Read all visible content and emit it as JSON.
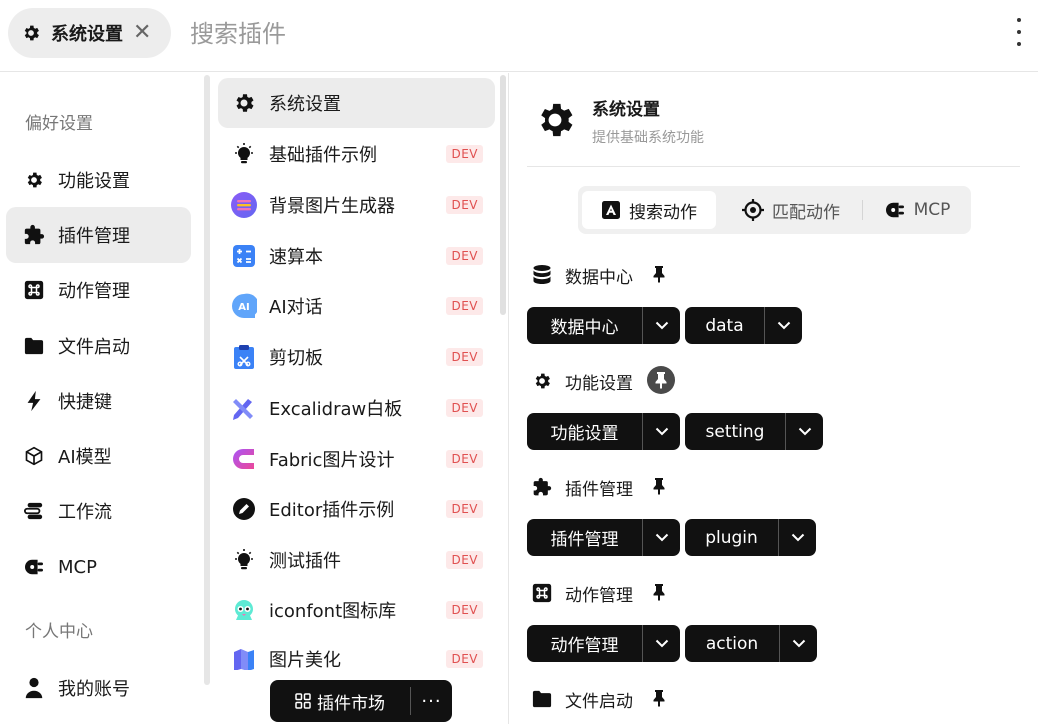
{
  "topbar": {
    "tab_label": "系统设置",
    "tab_close": "✕",
    "search_placeholder": "搜索插件"
  },
  "sidebar": {
    "section_preferences": "偏好设置",
    "section_personal": "个人中心",
    "items": [
      {
        "label": "功能设置",
        "icon": "gear-icon"
      },
      {
        "label": "插件管理",
        "icon": "puzzle-icon"
      },
      {
        "label": "动作管理",
        "icon": "command-icon"
      },
      {
        "label": "文件启动",
        "icon": "folder-icon"
      },
      {
        "label": "快捷键",
        "icon": "bolt-icon"
      },
      {
        "label": "AI模型",
        "icon": "cube-icon"
      },
      {
        "label": "工作流",
        "icon": "workflow-icon"
      },
      {
        "label": "MCP",
        "icon": "mcp-plug-icon"
      }
    ],
    "personal_items": [
      {
        "label": "我的账号",
        "icon": "user-icon"
      }
    ],
    "active_item": "插件管理"
  },
  "plugin_list": {
    "items": [
      {
        "label": "系统设置",
        "icon": "gear-icon",
        "badge": ""
      },
      {
        "label": "基础插件示例",
        "icon": "lightbulb-icon",
        "badge": "DEV"
      },
      {
        "label": "背景图片生成器",
        "icon": "gradient-icon",
        "badge": "DEV"
      },
      {
        "label": "速算本",
        "icon": "calculator-icon",
        "badge": "DEV"
      },
      {
        "label": "AI对话",
        "icon": "ai-chat-icon",
        "badge": "DEV"
      },
      {
        "label": "剪切板",
        "icon": "clipboard-icon",
        "badge": "DEV"
      },
      {
        "label": "Excalidraw白板",
        "icon": "excalidraw-icon",
        "badge": "DEV"
      },
      {
        "label": "Fabric图片设计",
        "icon": "fabric-icon",
        "badge": "DEV"
      },
      {
        "label": "Editor插件示例",
        "icon": "pen-icon",
        "badge": "DEV"
      },
      {
        "label": "测试插件",
        "icon": "lightbulb-icon",
        "badge": "DEV"
      },
      {
        "label": "iconfont图标库",
        "icon": "iconfont-icon",
        "badge": "DEV"
      },
      {
        "label": "图片美化",
        "icon": "image-beautify-icon",
        "badge": "DEV"
      }
    ],
    "active_item": "系统设置",
    "market_button": "插件市场",
    "more_button": "···"
  },
  "detail": {
    "title": "系统设置",
    "subtitle": "提供基础系统功能",
    "tabs": [
      {
        "label": "搜索动作",
        "icon": "letter-a-icon",
        "active": true
      },
      {
        "label": "匹配动作",
        "icon": "target-icon",
        "active": false
      },
      {
        "label": "MCP",
        "icon": "mcp-plug-icon",
        "active": false
      }
    ],
    "features": [
      {
        "label": "数据中心",
        "icon": "database-icon",
        "pinned": false,
        "value": "数据中心",
        "code": "data"
      },
      {
        "label": "功能设置",
        "icon": "gear-icon",
        "pinned": true,
        "value": "功能设置",
        "code": "setting"
      },
      {
        "label": "插件管理",
        "icon": "puzzle-icon",
        "pinned": false,
        "value": "插件管理",
        "code": "plugin"
      },
      {
        "label": "动作管理",
        "icon": "command-icon",
        "pinned": false,
        "value": "动作管理",
        "code": "action"
      },
      {
        "label": "文件启动",
        "icon": "folder-icon",
        "pinned": false
      }
    ]
  },
  "colors": {
    "dev_badge_bg": "#fde9e9",
    "dev_badge_text": "#e05050",
    "active_bg": "#ececec",
    "dark_button": "#111111"
  }
}
